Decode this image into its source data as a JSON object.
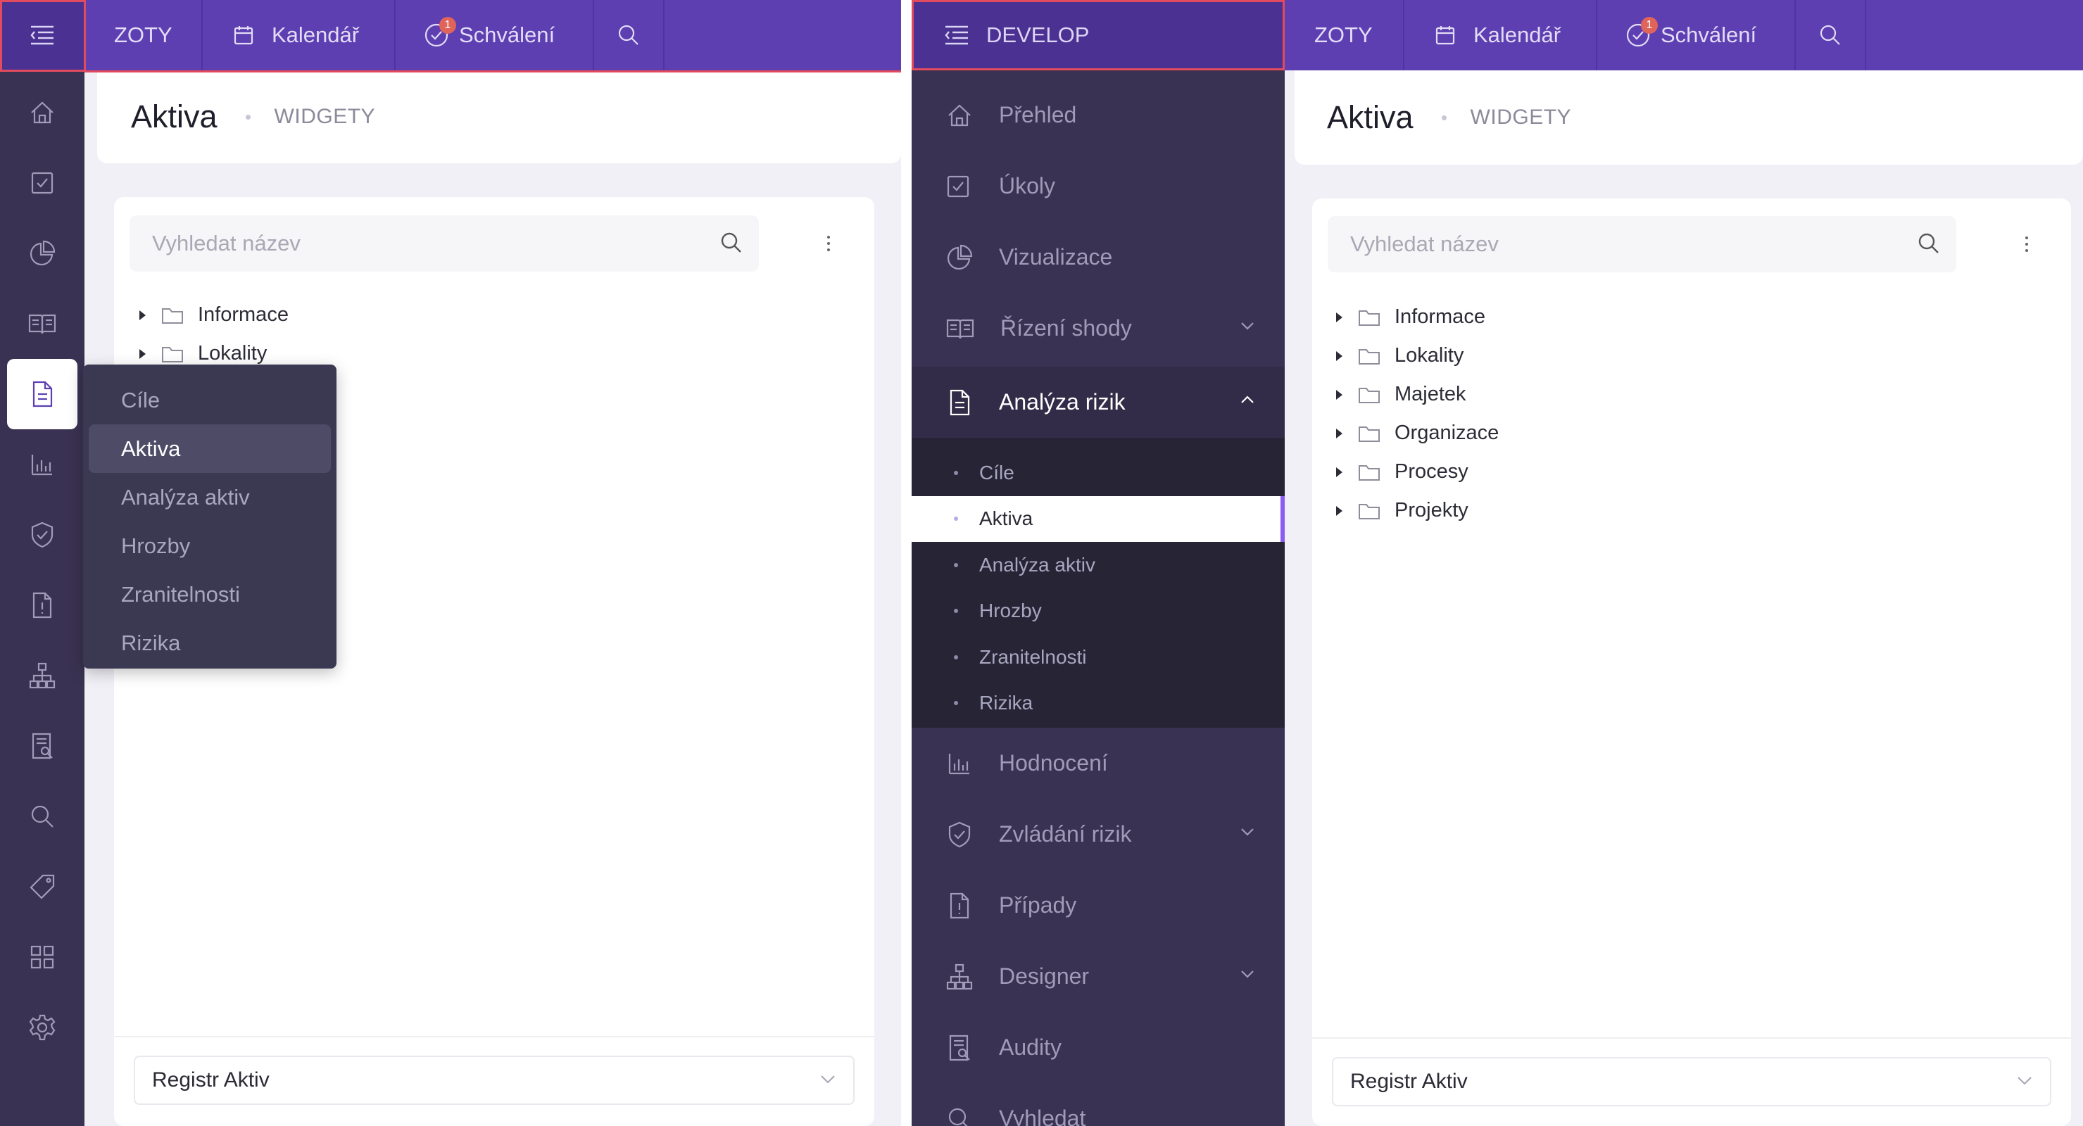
{
  "left": {
    "topbar": {
      "org": "ZOTY",
      "calendar": "Kalendář",
      "approvals": "Schválení",
      "approvals_badge": "1"
    },
    "header": {
      "title": "Aktiva",
      "subtitle": "WIDGETY"
    },
    "search": {
      "placeholder": "Vyhledat název",
      "value": ""
    },
    "tree": [
      "Informace",
      "Lokality"
    ],
    "flyout": {
      "items": [
        "Cíle",
        "Aktiva",
        "Analýza aktiv",
        "Hrozby",
        "Zranitelnosti",
        "Rizika"
      ],
      "active": "Aktiva"
    },
    "rail_icons": [
      "home-icon",
      "task-check-icon",
      "pie-chart-icon",
      "book-icon",
      "document-icon",
      "bar-chart-icon",
      "shield-check-icon",
      "file-alert-icon",
      "sitemap-icon",
      "audit-icon",
      "search-icon",
      "tag-icon",
      "grid-icon",
      "gear-icon"
    ],
    "footer": {
      "select_value": "Registr Aktiv"
    }
  },
  "right": {
    "toggle_label": "DEVELOP",
    "topbar": {
      "org": "ZOTY",
      "calendar": "Kalendář",
      "approvals": "Schválení",
      "approvals_badge": "1"
    },
    "sidebar": {
      "items": [
        {
          "label": "Přehled",
          "icon": "home-icon"
        },
        {
          "label": "Úkoly",
          "icon": "task-check-icon"
        },
        {
          "label": "Vizualizace",
          "icon": "pie-chart-icon"
        },
        {
          "label": "Řízení shody",
          "icon": "book-icon"
        },
        {
          "label": "Analýza rizik",
          "icon": "document-icon"
        },
        {
          "label": "Hodnocení",
          "icon": "bar-chart-icon"
        },
        {
          "label": "Zvládání rizik",
          "icon": "shield-check-icon"
        },
        {
          "label": "Případy",
          "icon": "file-alert-icon"
        },
        {
          "label": "Designer",
          "icon": "sitemap-icon"
        },
        {
          "label": "Audity",
          "icon": "audit-icon"
        },
        {
          "label": "Vyhledat",
          "icon": "search-icon"
        }
      ],
      "submenu": [
        "Cíle",
        "Aktiva",
        "Analýza aktiv",
        "Hrozby",
        "Zranitelnosti",
        "Rizika"
      ],
      "active_sub": "Aktiva"
    },
    "header": {
      "title": "Aktiva",
      "subtitle": "WIDGETY"
    },
    "search": {
      "placeholder": "Vyhledat název",
      "value": ""
    },
    "tree": [
      "Informace",
      "Lokality",
      "Majetek",
      "Organizace",
      "Procesy",
      "Projekty"
    ],
    "footer": {
      "select_value": "Registr Aktiv"
    }
  },
  "colors": {
    "topbar": "#5d3fb2",
    "sidebar": "#3a3252",
    "submenu_bg": "#262435",
    "accent": "#8a5cf0",
    "callout": "#e24b5e",
    "badge": "#e0645a"
  }
}
